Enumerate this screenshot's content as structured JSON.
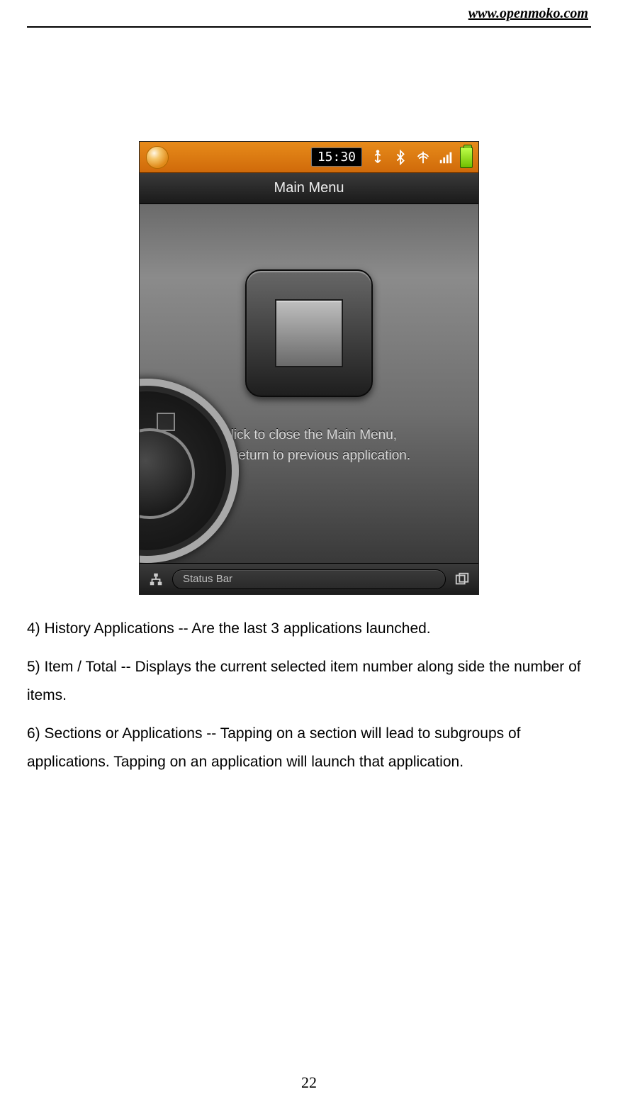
{
  "header": {
    "url": "www.openmoko.com"
  },
  "screenshot": {
    "statusbar": {
      "time": "15:30",
      "icons": {
        "logo": "openmoko-logo",
        "usb": "usb-icon",
        "bluetooth": "bluetooth-icon",
        "wifi": "wifi-icon",
        "signal": "signal-icon",
        "battery": "battery-icon"
      }
    },
    "titlebar": {
      "title": "Main Menu"
    },
    "hint": {
      "line1": "Click to close the Main Menu,",
      "line2": "and return to previous application."
    },
    "bottombar": {
      "status_label": "Status Bar"
    }
  },
  "paragraphs": {
    "p4": "4) History Applications -- Are the last 3 applications launched.",
    "p5": "5) Item / Total -- Displays the current selected item number along side the number of items.",
    "p6": "6) Sections or Applications -- Tapping on a section will lead to subgroups of applications. Tapping on an application will launch that application."
  },
  "page_number": "22"
}
